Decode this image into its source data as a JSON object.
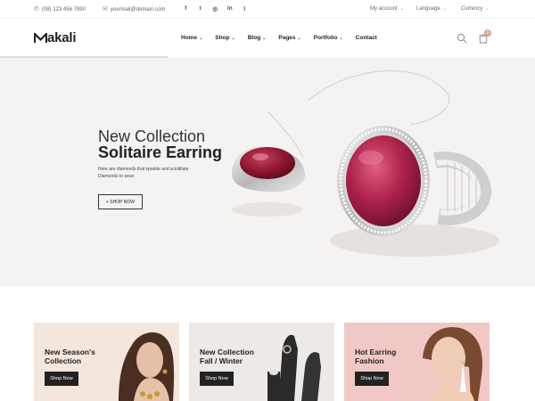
{
  "topbar": {
    "phone": "(08) 123 456 7890",
    "email": "yourmail@domain.com",
    "social_icons": [
      "facebook-icon",
      "twitter-icon",
      "instagram-icon",
      "linkedin-icon",
      "rss-icon"
    ],
    "social_glyphs": [
      "f",
      "t",
      "◎",
      "in",
      "⌇"
    ],
    "account": "My account",
    "language": "Language",
    "currency": "Currency"
  },
  "header": {
    "logo": "akali",
    "nav": [
      "Home",
      "Shop",
      "Blog",
      "Pages",
      "Portfolio",
      "Contact"
    ],
    "cart_count": "0"
  },
  "hero": {
    "title_line1": "New Collection",
    "title_line2": "Solitaire Earring",
    "description": "Here are diamonds that sparkle and scintillate Diamonds to wear",
    "button": "+ SHOP NOW"
  },
  "banners": [
    {
      "title_line1": "New Season's",
      "title_line2": "Collection",
      "button": "Shop Now"
    },
    {
      "title_line1": "New Collection",
      "title_line2": "Fall / Winter",
      "button": "Shop Now"
    },
    {
      "title_line1": "Hot Earring",
      "title_line2": "Fashion",
      "button": "Shop Now"
    }
  ],
  "colors": {
    "accent": "#e0a58c",
    "hero_bg": "#f5f3f1",
    "ruby": "#b0244d"
  }
}
